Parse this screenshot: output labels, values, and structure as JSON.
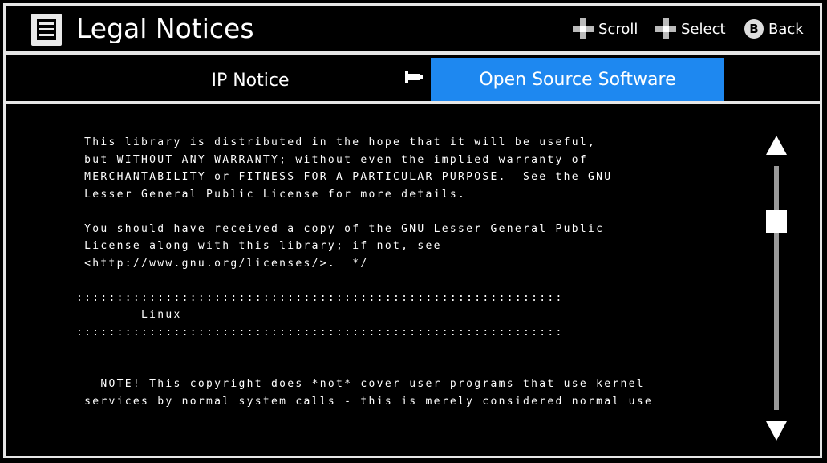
{
  "header": {
    "title": "Legal Notices",
    "hints": [
      {
        "icon": "dpad-icon",
        "label": "Scroll"
      },
      {
        "icon": "dpad-icon",
        "label": "Select"
      },
      {
        "icon": "b-button-icon",
        "label": "Back",
        "glyph": "B"
      }
    ]
  },
  "tabs": [
    {
      "label": "IP Notice",
      "selected": false
    },
    {
      "label": "Open Source Software",
      "selected": true
    }
  ],
  "content": {
    "lines": [
      " This library is distributed in the hope that it will be useful,",
      " but WITHOUT ANY WARRANTY; without even the implied warranty of",
      " MERCHANTABILITY or FITNESS FOR A PARTICULAR PURPOSE.  See the GNU",
      " Lesser General Public License for more details.",
      "",
      " You should have received a copy of the GNU Lesser General Public",
      " License along with this library; if not, see",
      " <http://www.gnu.org/licenses/>.  */",
      "",
      "::::::::::::::::::::::::::::::::::::::::::::::::::::::::::::",
      "        Linux",
      "::::::::::::::::::::::::::::::::::::::::::::::::::::::::::::",
      "",
      "",
      "   NOTE! This copyright does *not* cover user programs that use kernel",
      " services by normal system calls - this is merely considered normal use"
    ]
  },
  "scrollbar": {
    "position": 0.2
  },
  "colors": {
    "accent": "#1e88f0",
    "background": "#000000",
    "border": "#e6e6e6"
  }
}
